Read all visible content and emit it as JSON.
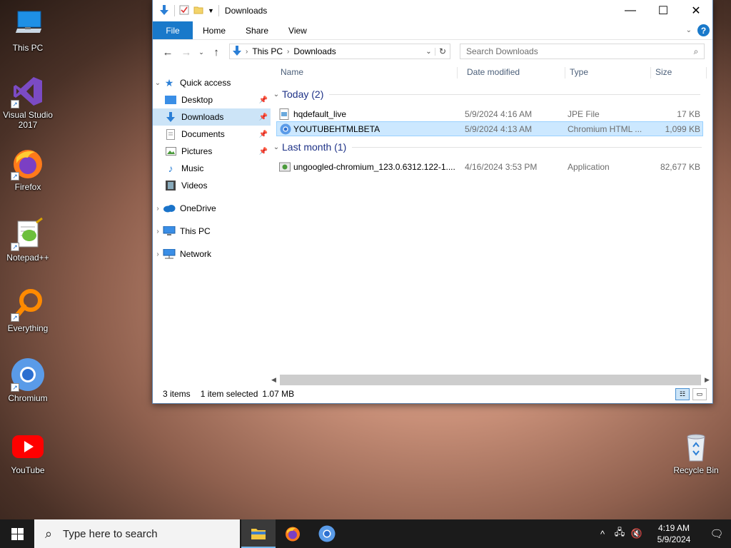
{
  "desktop": {
    "icons": [
      {
        "label": "This PC"
      },
      {
        "label": "Visual Studio 2017"
      },
      {
        "label": "Firefox"
      },
      {
        "label": "Notepad++"
      },
      {
        "label": "Everything"
      },
      {
        "label": "Chromium"
      },
      {
        "label": "YouTube"
      },
      {
        "label": "Recycle Bin"
      }
    ]
  },
  "explorer": {
    "title": "Downloads",
    "window_controls": {
      "minimize": "—",
      "maximize": "☐",
      "close": "✕"
    },
    "ribbon": {
      "file": "File",
      "tabs": [
        "Home",
        "Share",
        "View"
      ],
      "help": "?"
    },
    "address": {
      "crumbs": [
        "This PC",
        "Downloads"
      ]
    },
    "search": {
      "placeholder": "Search Downloads"
    },
    "nav_pane": {
      "quick_access": "Quick access",
      "items": [
        {
          "label": "Desktop",
          "pinned": true
        },
        {
          "label": "Downloads",
          "pinned": true,
          "selected": true
        },
        {
          "label": "Documents",
          "pinned": true
        },
        {
          "label": "Pictures",
          "pinned": true
        },
        {
          "label": "Music",
          "pinned": false
        },
        {
          "label": "Videos",
          "pinned": false
        }
      ],
      "onedrive": "OneDrive",
      "this_pc": "This PC",
      "network": "Network"
    },
    "columns": [
      "Name",
      "Date modified",
      "Type",
      "Size"
    ],
    "groups": [
      {
        "title": "Today (2)",
        "files": [
          {
            "name": "hqdefault_live",
            "date": "5/9/2024 4:16 AM",
            "type": "JPE File",
            "size": "17 KB",
            "selected": false
          },
          {
            "name": "YOUTUBEHTMLBETA",
            "date": "5/9/2024 4:13 AM",
            "type": "Chromium HTML ...",
            "size": "1,099 KB",
            "selected": true
          }
        ]
      },
      {
        "title": "Last month (1)",
        "files": [
          {
            "name": "ungoogled-chromium_123.0.6312.122-1....",
            "date": "4/16/2024 3:53 PM",
            "type": "Application",
            "size": "82,677 KB",
            "selected": false
          }
        ]
      }
    ],
    "status": {
      "items": "3 items",
      "selected": "1 item selected",
      "size": "1.07 MB"
    }
  },
  "taskbar": {
    "search_placeholder": "Type here to search",
    "apps": [
      "File Explorer",
      "Firefox",
      "Chromium"
    ],
    "clock_time": "4:19 AM",
    "clock_date": "5/9/2024"
  }
}
